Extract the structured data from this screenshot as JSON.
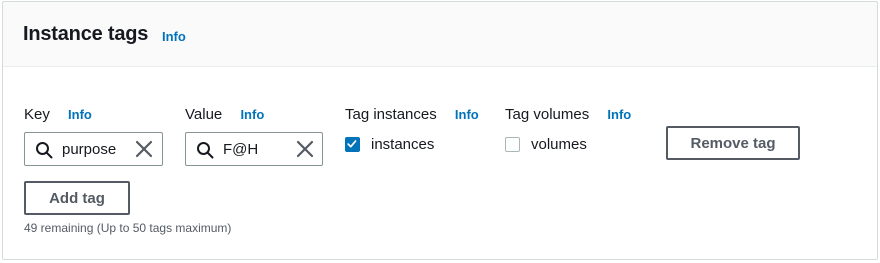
{
  "header": {
    "title": "Instance tags",
    "info": "Info"
  },
  "tag_row": {
    "key": {
      "label": "Key",
      "info": "Info",
      "value": "purpose"
    },
    "value": {
      "label": "Value",
      "info": "Info",
      "value": "F@H"
    },
    "tag_instances": {
      "label": "Tag instances",
      "info": "Info",
      "checkbox_label": "instances",
      "checked": true
    },
    "tag_volumes": {
      "label": "Tag volumes",
      "info": "Info",
      "checkbox_label": "volumes",
      "checked": false
    },
    "remove_button": "Remove tag"
  },
  "add_button": "Add tag",
  "remaining_hint": "49 remaining (Up to 50 tags maximum)",
  "colors": {
    "accent": "#0073bb",
    "border": "#879596",
    "text": "#16191f",
    "muted": "#545b64"
  },
  "icons": {
    "search": "search-icon",
    "clear": "close-icon",
    "check": "checkmark-icon"
  }
}
